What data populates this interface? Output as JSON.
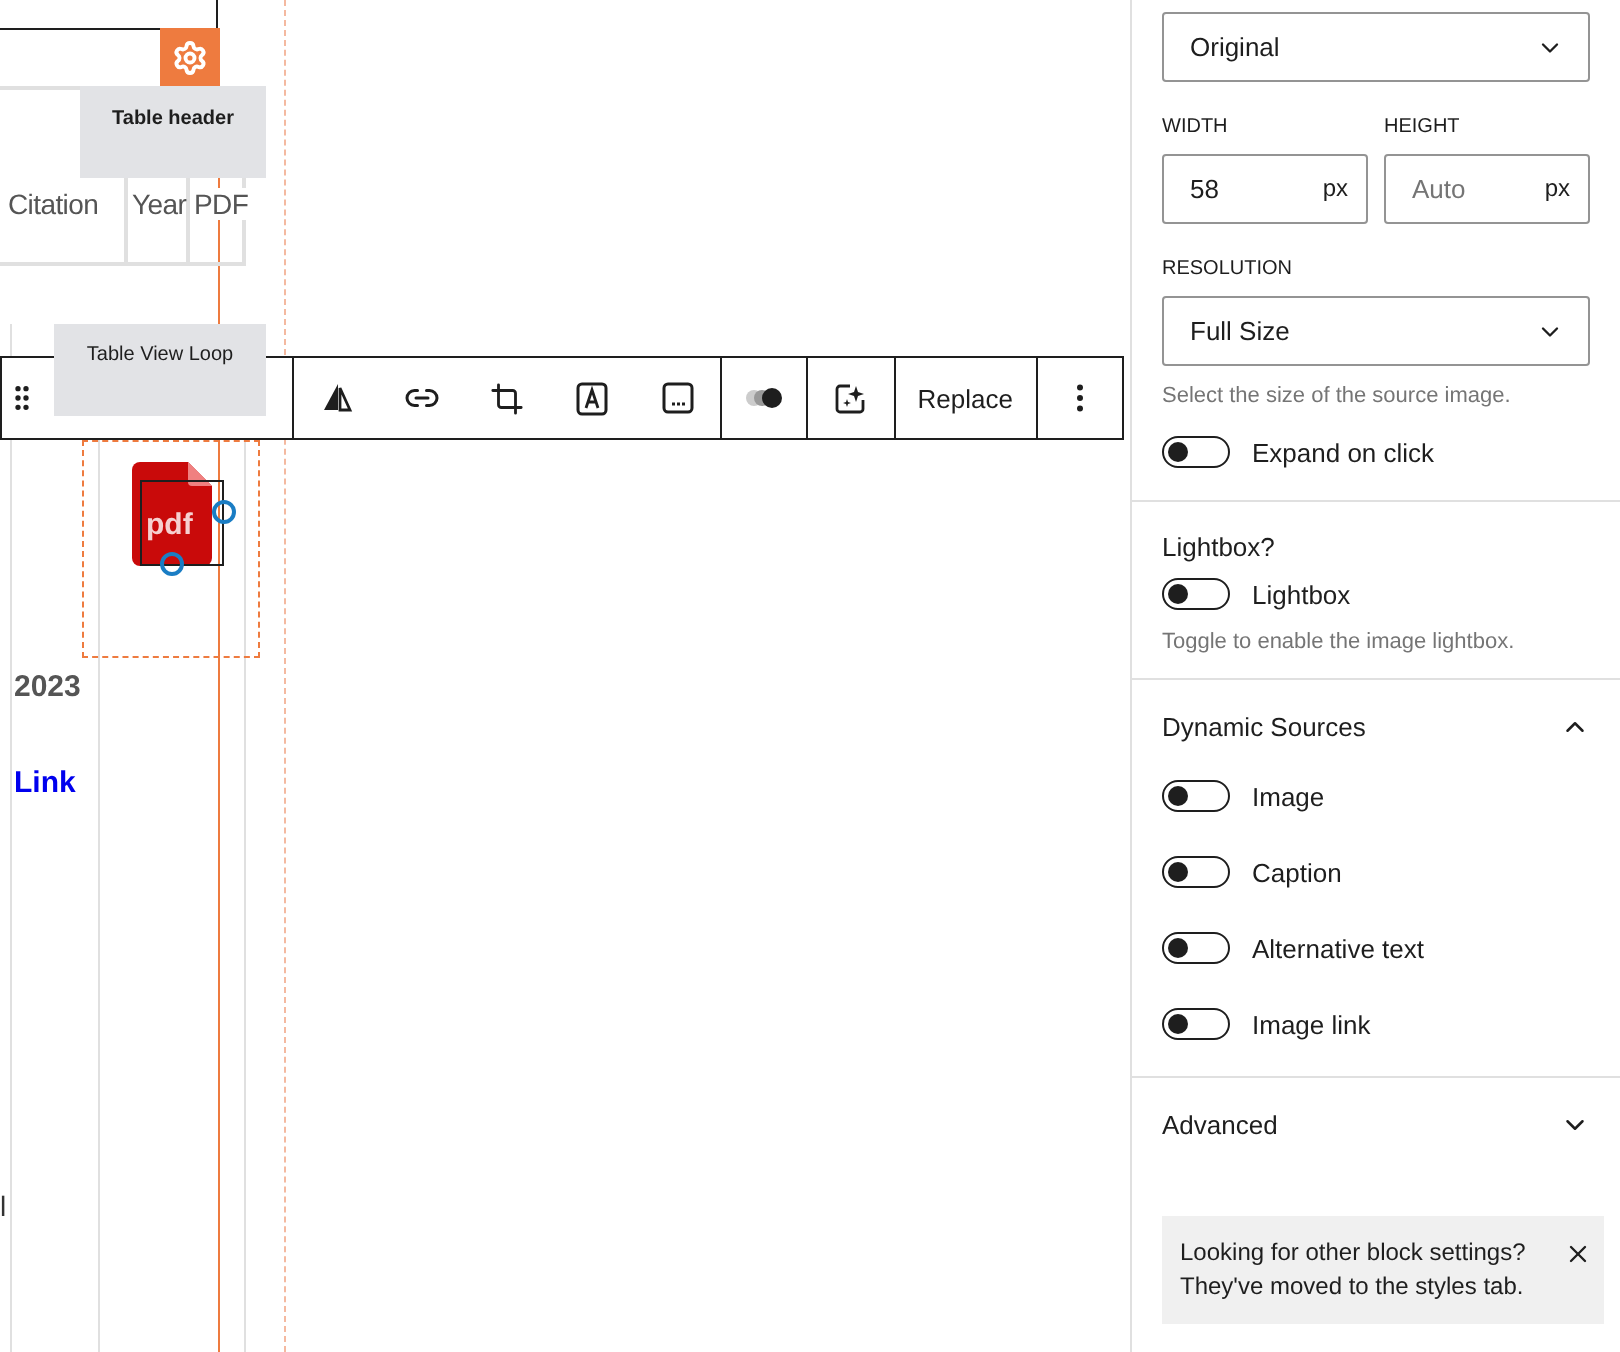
{
  "canvas": {
    "table_header": {
      "label": "Table header",
      "columns": [
        "Citation",
        "Year",
        "PDF"
      ]
    },
    "loop_label": "Table View Loop",
    "toolbar": {
      "replace_label": "Replace"
    },
    "row": {
      "year": "2023",
      "link": "Link",
      "fragment": "l"
    },
    "image": {
      "selected": true,
      "icon_text": "pdf"
    }
  },
  "sidebar": {
    "size_select": {
      "value": "Original"
    },
    "width": {
      "label": "WIDTH",
      "value": "58",
      "unit": "px"
    },
    "height": {
      "label": "HEIGHT",
      "placeholder": "Auto",
      "unit": "px"
    },
    "resolution": {
      "label": "RESOLUTION",
      "value": "Full Size",
      "help": "Select the size of the source image."
    },
    "expand_toggle": {
      "label": "Expand on click",
      "on": false
    },
    "lightbox": {
      "title": "Lightbox?",
      "toggle": {
        "label": "Lightbox",
        "on": false
      },
      "help": "Toggle to enable the image lightbox."
    },
    "dynamic_sources": {
      "title": "Dynamic Sources",
      "expanded": true,
      "toggles": [
        {
          "label": "Image",
          "on": false
        },
        {
          "label": "Caption",
          "on": false
        },
        {
          "label": "Alternative text",
          "on": false
        },
        {
          "label": "Image link",
          "on": false
        }
      ]
    },
    "advanced": {
      "title": "Advanced",
      "expanded": false
    },
    "notice": {
      "text": "Looking for other block settings? They've moved to the styles tab."
    }
  }
}
